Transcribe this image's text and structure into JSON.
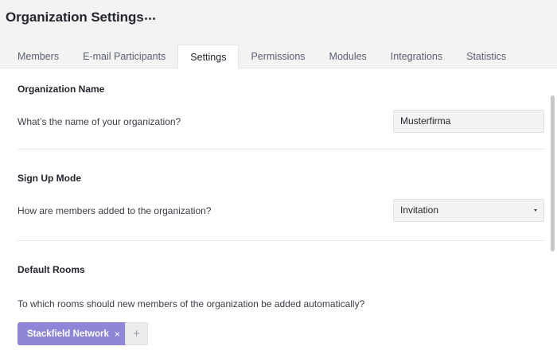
{
  "header": {
    "title": "Organization Settings",
    "more_icon": "more-horizontal-icon"
  },
  "tabs": [
    {
      "label": "Members",
      "active": false
    },
    {
      "label": "E-mail Participants",
      "active": false
    },
    {
      "label": "Settings",
      "active": true
    },
    {
      "label": "Permissions",
      "active": false
    },
    {
      "label": "Modules",
      "active": false
    },
    {
      "label": "Integrations",
      "active": false
    },
    {
      "label": "Statistics",
      "active": false
    }
  ],
  "sections": {
    "org_name": {
      "title": "Organization Name",
      "question": "What’s the name of your organization?",
      "value": "Musterfirma"
    },
    "signup": {
      "title": "Sign Up Mode",
      "question": "How are members added to the organization?",
      "selected": "Invitation"
    },
    "rooms": {
      "title": "Default Rooms",
      "question": "To which rooms should new members of the organization be added automatically?",
      "chips": [
        {
          "label": "Stackfield Network",
          "remove": "×"
        }
      ],
      "add": "+"
    }
  },
  "colors": {
    "accent": "#8f86d8",
    "header_bg": "#f3f3f4"
  }
}
